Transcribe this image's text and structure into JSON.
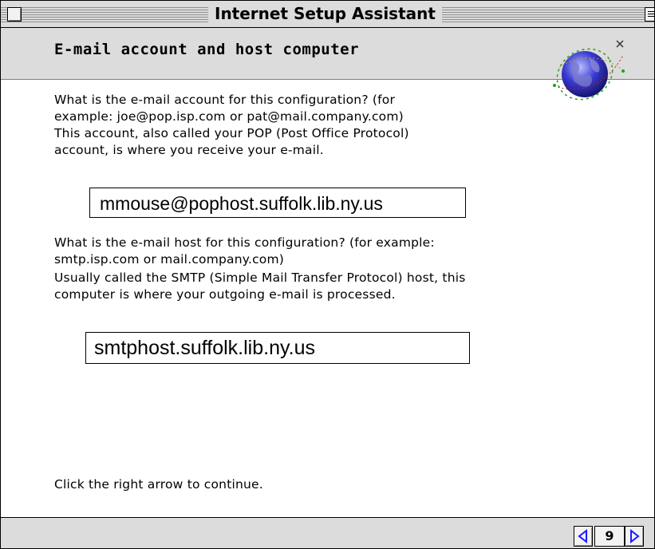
{
  "window": {
    "title": "Internet Setup Assistant"
  },
  "header": {
    "title": "E-mail account and host computer"
  },
  "account_section": {
    "lines": [
      "What is the e-mail account for this configuration? (for",
      "example: joe@pop.isp.com or pat@mail.company.com)",
      "This account, also called your POP (Post Office Protocol)",
      "account, is where you receive your e-mail."
    ],
    "value": "mmouse@pophost.suffolk.lib.ny.us"
  },
  "host_section": {
    "lines": [
      "What is the e-mail host for this configuration? (for example:",
      "smtp.isp.com or mail.company.com)",
      "Usually called the SMTP (Simple Mail Transfer Protocol) host, this",
      "computer is where your outgoing e-mail is processed."
    ],
    "value": "smtphost.suffolk.lib.ny.us"
  },
  "continue_text": "Click the right arrow to continue.",
  "footer": {
    "page_number": "9"
  },
  "icons": {
    "prev": "left-arrow-icon",
    "next": "right-arrow-icon",
    "globe": "globe-icon"
  },
  "colors": {
    "chrome": "#dcdcdc",
    "arrow": "#1a1aff"
  }
}
